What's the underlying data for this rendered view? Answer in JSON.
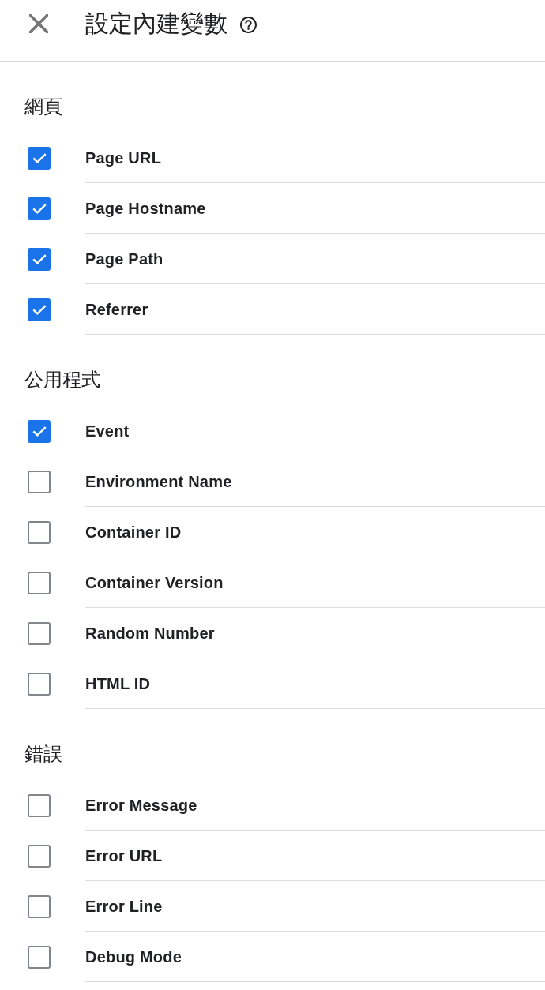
{
  "dialog": {
    "title": "設定內建變數"
  },
  "sections": [
    {
      "heading": "網頁",
      "items": [
        {
          "label": "Page URL",
          "checked": true
        },
        {
          "label": "Page Hostname",
          "checked": true
        },
        {
          "label": "Page Path",
          "checked": true
        },
        {
          "label": "Referrer",
          "checked": true
        }
      ]
    },
    {
      "heading": "公用程式",
      "items": [
        {
          "label": "Event",
          "checked": true
        },
        {
          "label": "Environment Name",
          "checked": false
        },
        {
          "label": "Container ID",
          "checked": false
        },
        {
          "label": "Container Version",
          "checked": false
        },
        {
          "label": "Random Number",
          "checked": false
        },
        {
          "label": "HTML ID",
          "checked": false
        }
      ]
    },
    {
      "heading": "錯誤",
      "items": [
        {
          "label": "Error Message",
          "checked": false
        },
        {
          "label": "Error URL",
          "checked": false
        },
        {
          "label": "Error Line",
          "checked": false
        },
        {
          "label": "Debug Mode",
          "checked": false
        }
      ]
    }
  ]
}
